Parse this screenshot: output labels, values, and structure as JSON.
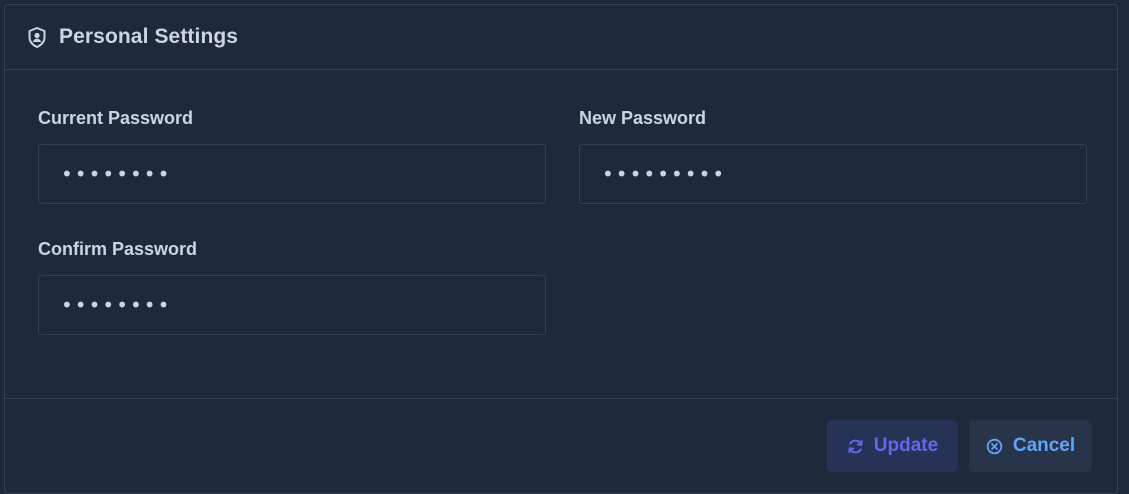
{
  "header": {
    "icon": "shield-user-icon",
    "title": "Personal Settings"
  },
  "form": {
    "current_password": {
      "label": "Current Password",
      "value": "••••••••"
    },
    "new_password": {
      "label": "New Password",
      "value": "•••••••••"
    },
    "confirm_password": {
      "label": "Confirm Password",
      "value": "••••••••"
    }
  },
  "footer": {
    "update_label": "Update",
    "update_icon": "refresh-icon",
    "cancel_label": "Cancel",
    "cancel_icon": "circle-x-icon"
  },
  "colors": {
    "background": "#1e293b",
    "border": "#334155",
    "text": "#cbd5e1",
    "update_accent": "#6366f1",
    "cancel_accent": "#60a5fa"
  }
}
